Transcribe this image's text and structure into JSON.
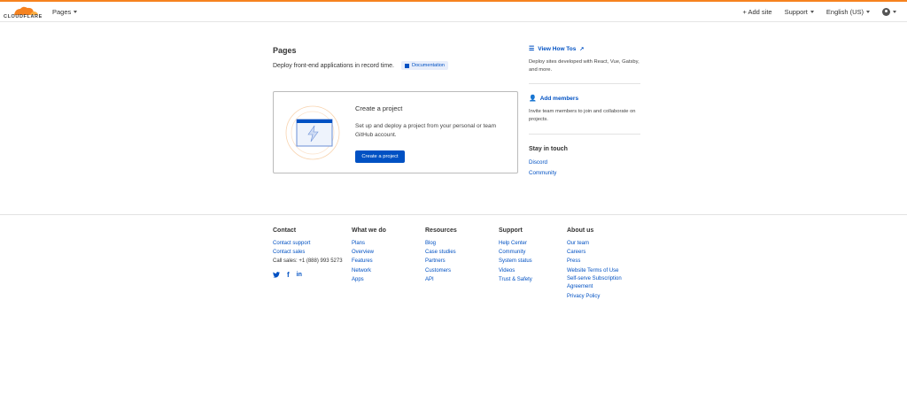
{
  "header": {
    "logo_text": "CLOUDFLARE",
    "nav_label": "Pages",
    "add_site": "+ Add site",
    "support": "Support",
    "language": "English (US)"
  },
  "page": {
    "title": "Pages",
    "subtitle": "Deploy front-end applications in record time.",
    "doc_badge": "Documentation"
  },
  "card": {
    "title": "Create a project",
    "description": "Set up and deploy a project from your personal or team GitHub account.",
    "button": "Create a project"
  },
  "sidebar": {
    "how_tos_link": "View How Tos",
    "how_tos_text": "Deploy sites developed with React, Vue, Gatsby, and more.",
    "add_members_link": "Add members",
    "add_members_text": "Invite team members to join and collaborate on projects.",
    "stay_title": "Stay in touch",
    "links": [
      "Discord",
      "Community"
    ]
  },
  "footer": {
    "contact": {
      "heading": "Contact",
      "links": [
        "Contact support",
        "Contact sales"
      ],
      "call": "Call sales: +1 (888) 993 5273"
    },
    "what_we_do": {
      "heading": "What we do",
      "links": [
        "Plans",
        "Overview",
        "Features",
        "Network",
        "Apps"
      ]
    },
    "resources": {
      "heading": "Resources",
      "links": [
        "Blog",
        "Case studies",
        "Partners",
        "Customers",
        "API"
      ]
    },
    "support": {
      "heading": "Support",
      "links": [
        "Help Center",
        "Community",
        "System status",
        "Videos",
        "Trust & Safety"
      ]
    },
    "about": {
      "heading": "About us",
      "links": [
        "Our team",
        "Careers",
        "Press",
        "Website Terms of Use",
        "Self-serve Subscription Agreement",
        "Privacy Policy"
      ]
    }
  },
  "colors": {
    "accent": "#f6821f",
    "link": "#0051c3"
  }
}
